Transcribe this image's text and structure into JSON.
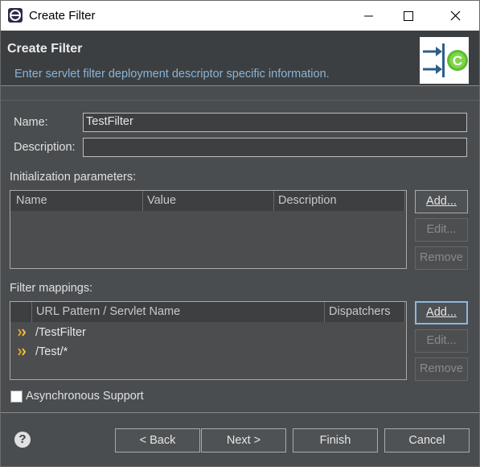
{
  "window": {
    "title": "Create Filter"
  },
  "header": {
    "title": "Create Filter",
    "subtitle": "Enter servlet filter deployment descriptor specific information."
  },
  "form": {
    "name_label": "Name:",
    "name_value": "TestFilter",
    "description_label": "Description:",
    "description_value": ""
  },
  "init_params": {
    "label": "Initialization parameters:",
    "columns": [
      "Name",
      "Value",
      "Description"
    ],
    "rows": [],
    "buttons": {
      "add": "Add...",
      "edit": "Edit...",
      "remove": "Remove"
    }
  },
  "filter_mappings": {
    "label": "Filter mappings:",
    "columns": [
      "URL Pattern / Servlet Name",
      "Dispatchers"
    ],
    "rows": [
      {
        "pattern": "/TestFilter",
        "dispatchers": ""
      },
      {
        "pattern": "/Test/*",
        "dispatchers": ""
      }
    ],
    "buttons": {
      "add": "Add...",
      "edit": "Edit...",
      "remove": "Remove"
    }
  },
  "async": {
    "label": "Asynchronous Support",
    "checked": false
  },
  "footer": {
    "help": "?",
    "back": "< Back",
    "next": "Next >",
    "finish": "Finish",
    "cancel": "Cancel"
  },
  "colors": {
    "accent": "#8ab4d8",
    "panel": "#4a4d50",
    "header": "#3c3f41"
  }
}
